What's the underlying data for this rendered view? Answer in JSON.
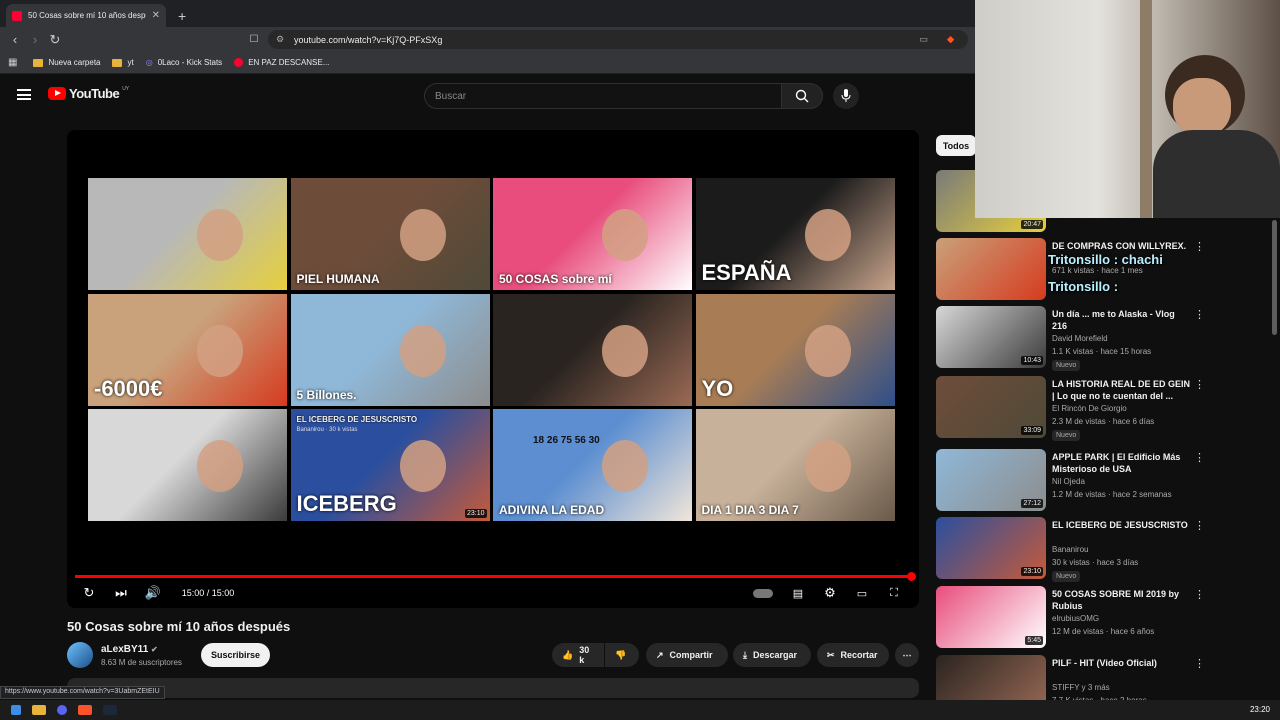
{
  "browser": {
    "tab_title": "50 Cosas sobre mí 10 años despu",
    "url": "youtube.com/watch?v=Kj7Q-PFxSXg",
    "bookmarks": [
      "Nueva carpeta",
      "yt",
      "0Laco - Kick Stats",
      "EN PAZ DESCANSE..."
    ],
    "status_url": "https://www.youtube.com/watch?v=3UabmZEtEIU"
  },
  "youtube": {
    "region": "UY",
    "logo_text": "YouTube",
    "search_placeholder": "Buscar"
  },
  "player": {
    "time": "15:00 / 15:00",
    "progress_fraction": 1.0,
    "endscreen": [
      {
        "caption": "",
        "colors": [
          "#b8b8b8",
          "#e6d03c"
        ]
      },
      {
        "caption": "PIEL HUMANA",
        "colors": [
          "#6e4c3a",
          "#4f4a37"
        ]
      },
      {
        "caption": "50 COSAS sobre mí",
        "colors": [
          "#e84d7d",
          "#ffffff"
        ]
      },
      {
        "caption": "ESPAÑA",
        "colors": [
          "#1b1b1b",
          "#c9a48b"
        ]
      },
      {
        "caption": "-6000€",
        "colors": [
          "#c9a17a",
          "#d63b1f"
        ]
      },
      {
        "caption": "5 Billones.",
        "colors": [
          "#8fb8d8",
          "#8d8d8d"
        ]
      },
      {
        "caption": "",
        "colors": [
          "#2a2420",
          "#9a6a55"
        ]
      },
      {
        "caption": "YO",
        "colors": [
          "#a87d55",
          "#2e4f8a"
        ]
      },
      {
        "caption": "",
        "colors": [
          "#d8d8d8",
          "#3b3b3b"
        ]
      },
      {
        "caption": "ICEBERG",
        "colors": [
          "#2b4f9e",
          "#c55a3a"
        ],
        "overlay_title": "EL ICEBERG DE JESUSCRISTO",
        "overlay_sub": "Bananirou · 30 k vistas",
        "duration": "23:10"
      },
      {
        "caption": "ADIVINA LA EDAD",
        "colors": [
          "#5c8ed1",
          "#f0e6d9"
        ],
        "ages": "18 26 75 56 30"
      },
      {
        "caption": "DIA 1   DIA 3   DIA 7",
        "colors": [
          "#c8b19a",
          "#6a5a4a"
        ]
      }
    ]
  },
  "video": {
    "title": "50 Cosas sobre mí 10 años después",
    "channel": "aLexBY11",
    "subscribers": "8.63 M de suscriptores",
    "subscribe_label": "Suscribirse",
    "likes": "30 k",
    "share_label": "Compartir",
    "download_label": "Descargar",
    "clip_label": "Recortar"
  },
  "sidebar": {
    "filter": "Todos",
    "items": [
      {
        "title": "DE COMPRAS CON WILLYREX.",
        "channel": "",
        "views": "671 k vistas · hace 1 mes",
        "duration": "",
        "badge": "",
        "colors": [
          "#c9a17a",
          "#d63b1f"
        ]
      },
      {
        "title": "Un día ... me to Alaska - Vlog 216",
        "channel": "David Morefield",
        "views": "1.1 K vistas · hace 15 horas",
        "duration": "10:43",
        "badge": "Nuevo",
        "colors": [
          "#d8d8d8",
          "#3b3b3b"
        ]
      },
      {
        "title": "LA HISTORIA REAL DE ED GEIN | Lo que no te cuentan del ...",
        "channel": "El Rincón De Giorgio",
        "views": "2.3 M de vistas · hace 6 días",
        "duration": "33:09",
        "badge": "Nuevo",
        "colors": [
          "#6e4c3a",
          "#4f4a37"
        ]
      },
      {
        "title": "APPLE PARK | El Edificio Más Misterioso de USA",
        "channel": "Nil Ojeda",
        "views": "1.2 M de vistas · hace 2 semanas",
        "duration": "27:12",
        "badge": "",
        "colors": [
          "#8fb8d8",
          "#8d8d8d"
        ]
      },
      {
        "title": "EL ICEBERG DE JESUSCRISTO",
        "channel": "Bananirou",
        "views": "30 k vistas · hace 3 días",
        "duration": "23:10",
        "badge": "Nuevo",
        "colors": [
          "#2b4f9e",
          "#c55a3a"
        ]
      },
      {
        "title": "50 COSAS SOBRE MI 2019 by Rubius",
        "channel": "elrubiusOMG",
        "views": "12 M de vistas · hace 6 años",
        "duration": "5:45",
        "badge": "",
        "colors": [
          "#e84d7d",
          "#ffffff"
        ]
      },
      {
        "title": "PILF - HIT (Video Oficial)",
        "channel": "STIFFY y 3 más",
        "views": "7.7 K vistas · hace 2 horas",
        "duration": "",
        "badge": "",
        "colors": [
          "#2a2420",
          "#9a6a55"
        ]
      }
    ],
    "top_partial_duration": "20:47"
  },
  "overlay_chat": [
    "Tritonsillo : chachi",
    "Tritonsillo :"
  ],
  "taskbar": {
    "clock": "23:20"
  }
}
